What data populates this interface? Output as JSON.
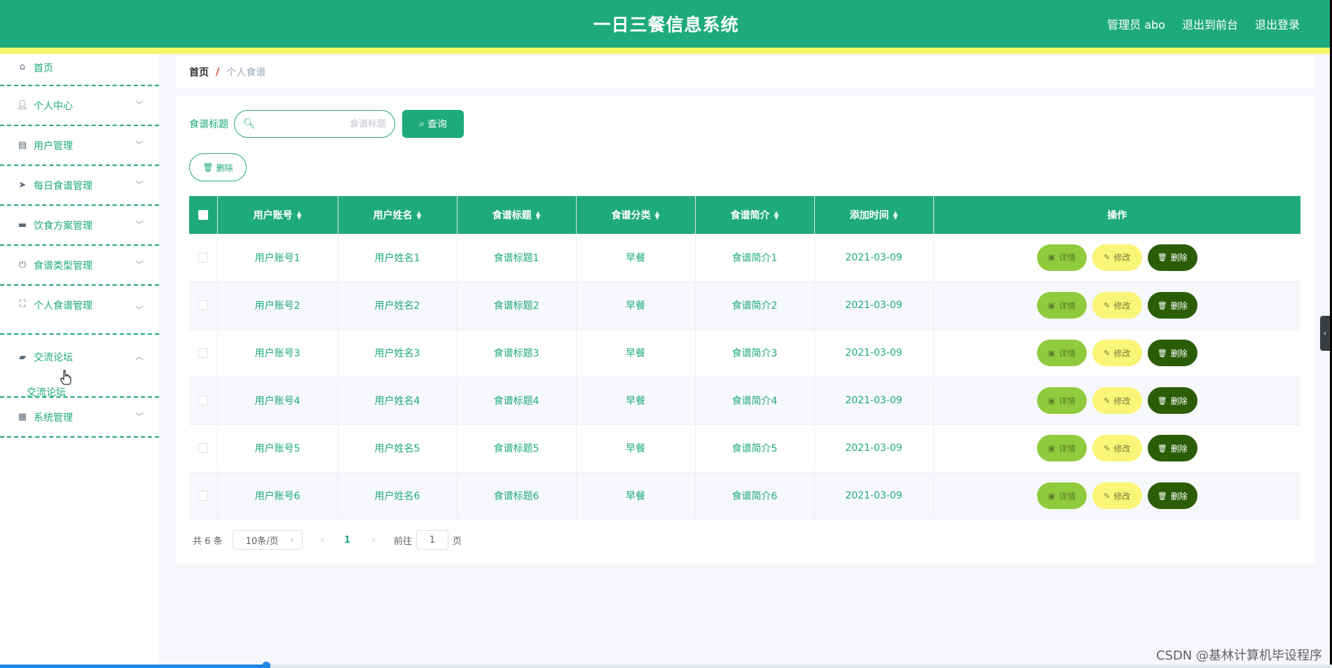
{
  "header": {
    "title": "一日三餐信息系统",
    "admin": "管理员 abo",
    "back_front": "退出到前台",
    "logout": "退出登录"
  },
  "sidebar": {
    "items": [
      {
        "label": "首页",
        "icon": "home-icon"
      },
      {
        "label": "个人中心",
        "icon": "user-icon"
      },
      {
        "label": "用户管理",
        "icon": "id-card-icon"
      },
      {
        "label": "每日食谱管理",
        "icon": "paper-plane-icon"
      },
      {
        "label": "饮食方案管理",
        "icon": "monitor-icon"
      },
      {
        "label": "食谱类型管理",
        "icon": "power-icon"
      },
      {
        "label": "个人食谱管理",
        "icon": "fullscreen-icon"
      },
      {
        "label": "交流论坛",
        "icon": "briefcase-icon",
        "sub": "交流论坛"
      },
      {
        "label": "系统管理",
        "icon": "grid-icon"
      }
    ]
  },
  "breadcrumb": {
    "home": "首页",
    "sep": "/",
    "current": "个人食谱"
  },
  "search": {
    "label": "食谱标题",
    "placeholder": "食谱标题",
    "button": "查询"
  },
  "toolbar": {
    "delete": "删除"
  },
  "table": {
    "columns": [
      "用户账号",
      "用户姓名",
      "食谱标题",
      "食谱分类",
      "食谱简介",
      "添加时间",
      "操作"
    ],
    "rows": [
      [
        "用户账号1",
        "用户姓名1",
        "食谱标题1",
        "早餐",
        "食谱简介1",
        "2021-03-09"
      ],
      [
        "用户账号2",
        "用户姓名2",
        "食谱标题2",
        "早餐",
        "食谱简介2",
        "2021-03-09"
      ],
      [
        "用户账号3",
        "用户姓名3",
        "食谱标题3",
        "早餐",
        "食谱简介3",
        "2021-03-09"
      ],
      [
        "用户账号4",
        "用户姓名4",
        "食谱标题4",
        "早餐",
        "食谱简介4",
        "2021-03-09"
      ],
      [
        "用户账号5",
        "用户姓名5",
        "食谱标题5",
        "早餐",
        "食谱简介5",
        "2021-03-09"
      ],
      [
        "用户账号6",
        "用户姓名6",
        "食谱标题6",
        "早餐",
        "食谱简介6",
        "2021-03-09"
      ]
    ],
    "actions": {
      "detail": "详情",
      "edit": "修改",
      "delete": "删除"
    }
  },
  "pagination": {
    "total": "共 6 条",
    "page_size": "10条/页",
    "current_page": "1",
    "goto": "前往",
    "goto_value": "1",
    "unit": "页"
  },
  "colors": {
    "primary": "#1eaa7c",
    "strip": "#f7f86a",
    "detail": "#8fcb3c",
    "edit": "#f8f577",
    "delete": "#2b5d06"
  },
  "progress": 0.2,
  "watermark": "CSDN @基林计算机毕设程序"
}
